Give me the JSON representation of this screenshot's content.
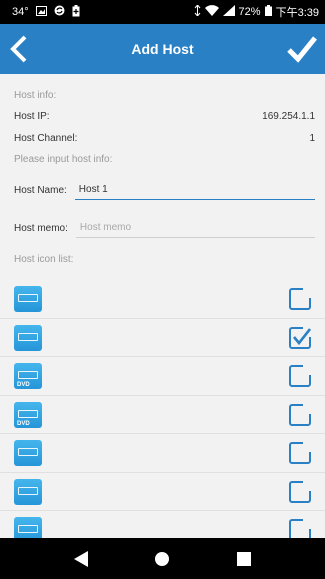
{
  "status_bar": {
    "temperature": "34°",
    "battery": "72%",
    "time": "下午3:39"
  },
  "header": {
    "title": "Add Host"
  },
  "host_info": {
    "section_label": "Host info:",
    "ip_label": "Host IP:",
    "ip_value": "169.254.1.1",
    "channel_label": "Host Channel:",
    "channel_value": "1"
  },
  "input_section": {
    "label": "Please input host info:",
    "name_label": "Host Name:",
    "name_value": "Host 1",
    "memo_label": "Host memo:",
    "memo_placeholder": "Host memo"
  },
  "icon_list": {
    "label": "Host icon list:",
    "items": [
      {
        "icon": "receiver-icon",
        "tag": "",
        "checked": false
      },
      {
        "icon": "satellite-receiver-icon",
        "tag": "",
        "checked": true
      },
      {
        "icon": "dvd-player-icon",
        "tag": "DVD",
        "checked": false
      },
      {
        "icon": "dvd-recorder-icon",
        "tag": "DVD",
        "checked": false
      },
      {
        "icon": "media-box-icon",
        "tag": "",
        "checked": false
      },
      {
        "icon": "set-top-box-icon",
        "tag": "",
        "checked": false
      },
      {
        "icon": "tuner-icon",
        "tag": "",
        "checked": false
      }
    ]
  },
  "colors": {
    "accent": "#2a80c4",
    "icon_fill": "#2595d8"
  }
}
